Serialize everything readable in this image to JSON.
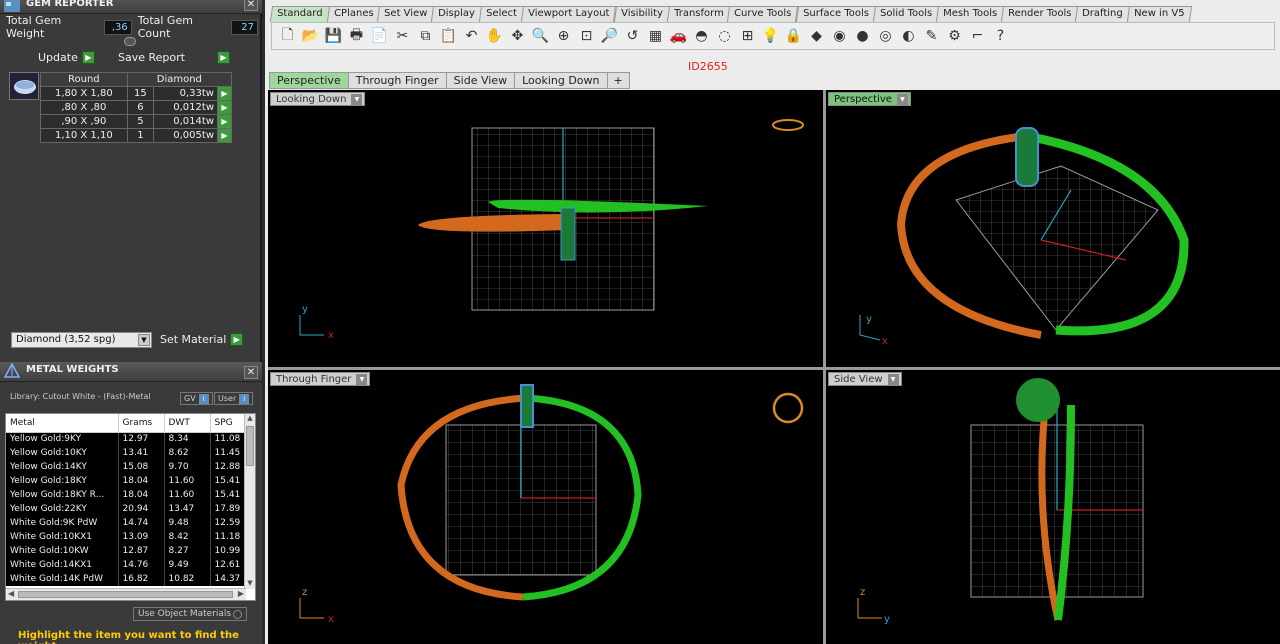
{
  "gem_reporter": {
    "title": "GEM REPORTER",
    "total_gem_weight_label": "Total Gem Weight",
    "total_gem_weight": ",36",
    "total_gem_count_label": "Total Gem Count",
    "total_gem_count": "27",
    "update_label": "Update",
    "save_report_label": "Save Report",
    "columns": [
      "Round",
      "Diamond"
    ],
    "rows": [
      {
        "size": "1,80 X 1,80",
        "count": "15",
        "weight": "0,33tw"
      },
      {
        "size": ",80 X ,80",
        "count": "6",
        "weight": "0,012tw"
      },
      {
        "size": ",90 X ,90",
        "count": "5",
        "weight": "0,014tw"
      },
      {
        "size": "1,10 X 1,10",
        "count": "1",
        "weight": "0,005tw"
      }
    ],
    "material_select": "Diamond    (3,52 spg)",
    "set_material_label": "Set Material"
  },
  "metal_weights": {
    "title": "METAL WEIGHTS",
    "library": "Library: Cutout White - (Fast)-Metal",
    "gv_label": "GV",
    "user_label": "User",
    "columns": [
      "Metal",
      "Grams",
      "DWT",
      "SPG"
    ],
    "rows": [
      [
        "Yellow Gold:9KY",
        "12.97",
        "8.34",
        "11.08"
      ],
      [
        "Yellow Gold:10KY",
        "13.41",
        "8.62",
        "11.45"
      ],
      [
        "Yellow Gold:14KY",
        "15.08",
        "9.70",
        "12.88"
      ],
      [
        "Yellow Gold:18KY",
        "18.04",
        "11.60",
        "15.41"
      ],
      [
        "Yellow Gold:18KY R...",
        "18.04",
        "11.60",
        "15.41"
      ],
      [
        "Yellow Gold:22KY",
        "20.94",
        "13.47",
        "17.89"
      ],
      [
        "White Gold:9K PdW",
        "14.74",
        "9.48",
        "12.59"
      ],
      [
        "White Gold:10KX1",
        "13.09",
        "8.42",
        "11.18"
      ],
      [
        "White Gold:10KW",
        "12.87",
        "8.27",
        "10.99"
      ],
      [
        "White Gold:14KX1",
        "14.76",
        "9.49",
        "12.61"
      ],
      [
        "White Gold:14K PdW",
        "16.82",
        "10.82",
        "14.37"
      ]
    ],
    "use_object_materials": "Use Object Materials",
    "hint": "Highlight the item you want to find the weight"
  },
  "rhino": {
    "toolbar_tabs": [
      "Standard",
      "CPlanes",
      "Set View",
      "Display",
      "Select",
      "Viewport Layout",
      "Visibility",
      "Transform",
      "Curve Tools",
      "Surface Tools",
      "Solid Tools",
      "Mesh Tools",
      "Render Tools",
      "Drafting",
      "New in V5"
    ],
    "tools": [
      "new-icon",
      "open-icon",
      "save-icon",
      "print-icon",
      "import-icon",
      "cut-icon",
      "copy-icon",
      "paste-icon",
      "undo-icon",
      "pan-icon",
      "rotate-icon",
      "zoom-icon",
      "zoom-window-icon",
      "zoom-extents-icon",
      "zoom-selected-icon",
      "undo-view-icon",
      "four-view-icon",
      "car-icon",
      "hide-icon",
      "lock-icon",
      "grid-snap-icon",
      "light-icon",
      "layer-lock-icon",
      "material-icon",
      "color-wheel-icon",
      "shaded-icon",
      "rendered-icon",
      "ghosted-icon",
      "options-icon",
      "gear-icon",
      "osnap-icon",
      "help-icon"
    ],
    "tool_glyphs": [
      "🗋",
      "📂",
      "💾",
      "🖶",
      "📄",
      "✂",
      "⧉",
      "📋",
      "↶",
      "✋",
      "✥",
      "🔍",
      "⊕",
      "⊡",
      "🔎",
      "↺",
      "▦",
      "🚗",
      "◓",
      "◌",
      "⊞",
      "💡",
      "🔒",
      "◆",
      "◉",
      "●",
      "◎",
      "◐",
      "✎",
      "⚙",
      "⌐",
      "?"
    ],
    "id_label": "ID2655",
    "viewport_tabs": [
      "Perspective",
      "Through Finger",
      "Side View",
      "Looking Down",
      "+"
    ],
    "viewports": {
      "top_left": "Looking Down",
      "top_right": "Perspective",
      "bottom_left": "Through Finger",
      "bottom_right": "Side View"
    },
    "axes": {
      "top_left": [
        "y",
        "x"
      ],
      "top_right": [
        "y",
        "x"
      ],
      "bottom_left": [
        "z",
        "x"
      ],
      "bottom_right": [
        "z",
        "y"
      ]
    }
  },
  "colors": {
    "orange": "#d2691e",
    "green": "#22c022",
    "blue_gem": "#4a8fd4",
    "grid": "#8a8a8a"
  }
}
